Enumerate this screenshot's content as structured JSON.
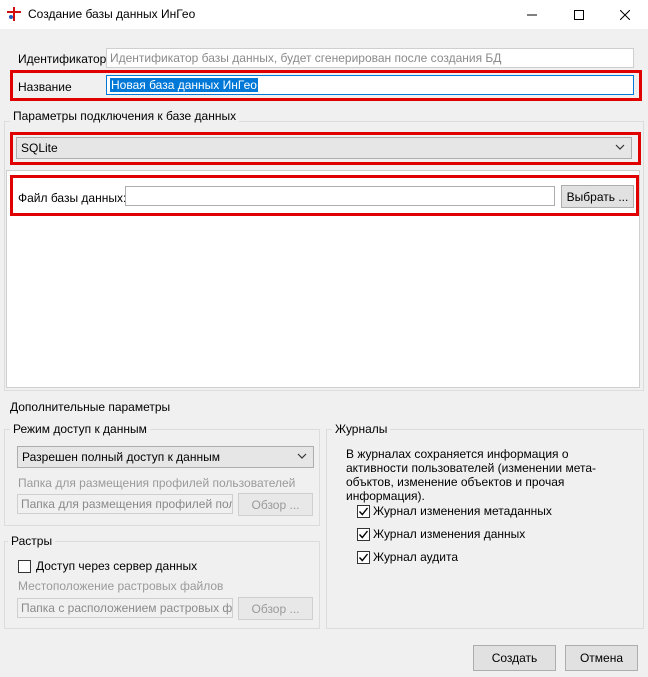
{
  "window": {
    "title": "Создание базы данных ИнГео",
    "icons": {
      "app": "ingeo-app-icon",
      "minimize": "minimize-icon",
      "maximize": "maximize-icon",
      "close": "close-icon"
    }
  },
  "identifier": {
    "label": "Идентификатор",
    "placeholder": "Идентификатор базы данных, будет сгенерирован после создания БД"
  },
  "name": {
    "label": "Название",
    "value": "Новая база данных ИнГео"
  },
  "connection": {
    "group_title": "Параметры подключения к базе данных",
    "provider": "SQLite",
    "file_label": "Файл базы данных:",
    "file_value": "",
    "browse_label": "Выбрать ..."
  },
  "additional": {
    "title": "Дополнительные параметры",
    "access": {
      "group_title": "Режим доступ к данным",
      "mode": "Разрешен полный доступ к данным",
      "profiles_label": "Папка для размещения профилей пользователей",
      "profiles_placeholder": "Папка для размещения профилей пользователей",
      "browse_label": "Обзор ..."
    },
    "rasters": {
      "group_title": "Растры",
      "server_access_label": "Доступ через сервер данных",
      "server_access_checked": false,
      "location_label": "Местоположение растровых файлов",
      "location_placeholder": "Папка с расположением растровых файлов",
      "browse_label": "Обзор ..."
    },
    "journals": {
      "group_title": "Журналы",
      "description": "В журналах сохраняется информация о активности пользователей (изменении мета-объктов, изменение объектов и прочая информация).",
      "items": [
        {
          "label": "Журнал изменения метаданных",
          "checked": true
        },
        {
          "label": "Журнал изменения данных",
          "checked": true
        },
        {
          "label": "Журнал аудита",
          "checked": true
        }
      ]
    }
  },
  "footer": {
    "create_label": "Создать",
    "cancel_label": "Отмена"
  }
}
